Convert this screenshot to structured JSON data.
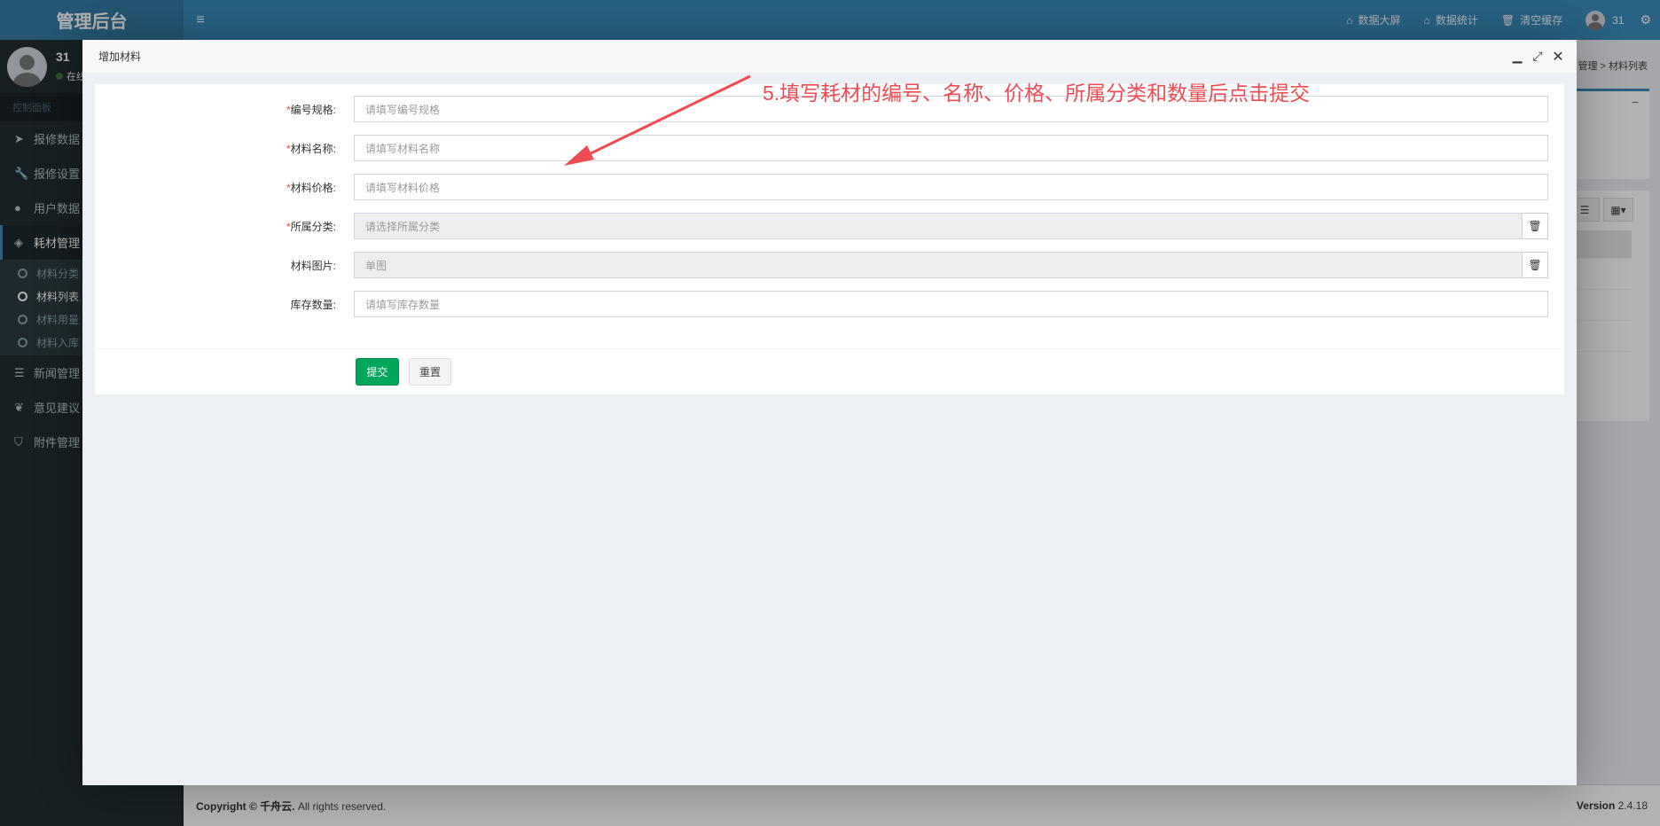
{
  "app": {
    "logo": "管理后台",
    "toggle_icon": "hamburger-icon"
  },
  "topbar": {
    "links": [
      {
        "label": "数据大屏",
        "icon": "home-icon"
      },
      {
        "label": "数据统计",
        "icon": "home-icon"
      },
      {
        "label": "清空缓存",
        "icon": "trash-icon"
      }
    ],
    "user": "31",
    "settings_icon": "gears-icon"
  },
  "sidebar": {
    "user_name": "31",
    "user_status": "在线",
    "menu_header": "控制面板",
    "items": [
      {
        "label": "报修数据",
        "icon": "paper-plane-icon"
      },
      {
        "label": "报修设置",
        "icon": "wrench-icon"
      },
      {
        "label": "用户数据",
        "icon": "user-icon"
      },
      {
        "label": "耗材管理",
        "icon": "cube-icon"
      },
      {
        "label": "新闻管理",
        "icon": "rss-icon"
      },
      {
        "label": "意见建议",
        "icon": "leaf-icon"
      },
      {
        "label": "附件管理",
        "icon": "tags-icon"
      }
    ],
    "subitems": [
      {
        "label": "材料分类"
      },
      {
        "label": "材料列表"
      },
      {
        "label": "材料用量"
      },
      {
        "label": "材料入库"
      }
    ]
  },
  "background": {
    "breadcrumb_tail": "管理 > 材料列表"
  },
  "footer": {
    "copyright_bold": "Copyright © 千舟云.",
    "copyright_rest": " All rights reserved.",
    "version_label": "Version",
    "version_value": "2.4.18"
  },
  "modal": {
    "title": "增加材料",
    "fields": [
      {
        "label": "编号规格:",
        "required": true,
        "placeholder": "请填写编号规格"
      },
      {
        "label": "材料名称:",
        "required": true,
        "placeholder": "请填写材料名称"
      },
      {
        "label": "材料价格:",
        "required": true,
        "placeholder": "请填写材料价格"
      },
      {
        "label": "所属分类:",
        "required": true,
        "placeholder": "请选择所属分类"
      },
      {
        "label": "材料图片:",
        "required": false,
        "placeholder": "单图"
      },
      {
        "label": "库存数量:",
        "required": false,
        "placeholder": "请填写库存数量"
      }
    ],
    "submit_label": "提交",
    "reset_label": "重置"
  },
  "annotation": {
    "text": "5.填写耗材的编号、名称、价格、所属分类和数量后点击提交",
    "color": "#f04b52"
  }
}
